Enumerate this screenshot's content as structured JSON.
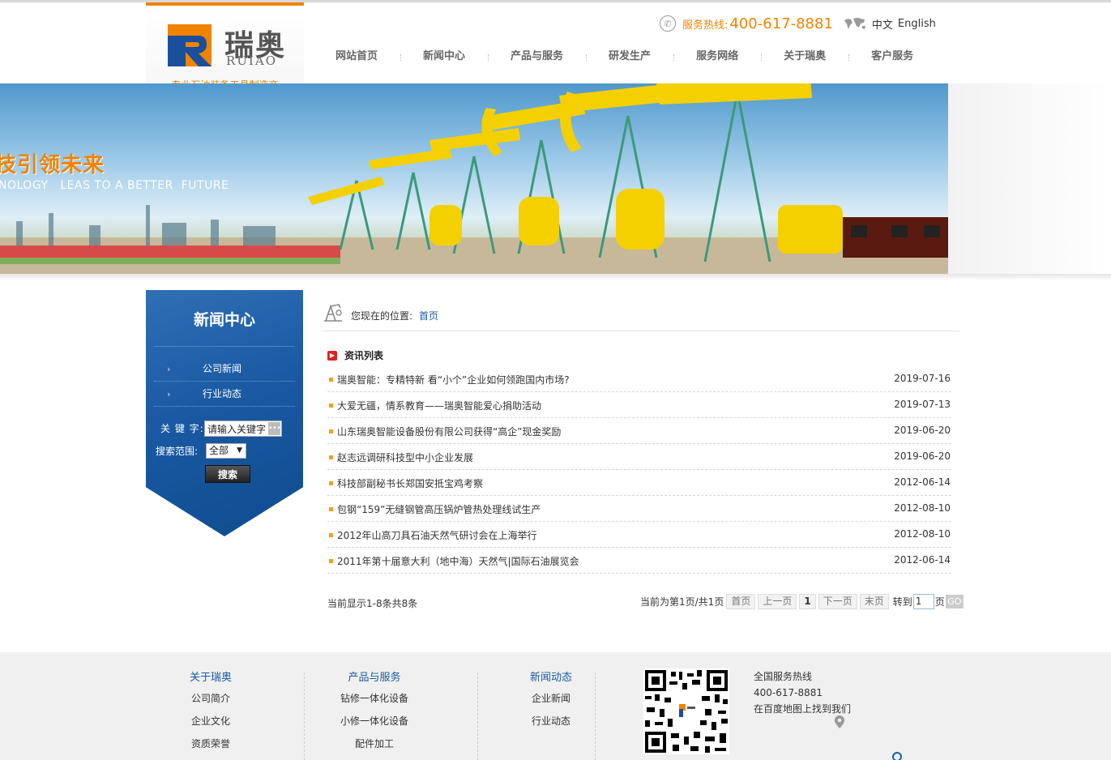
{
  "header": {
    "logo_cn": "瑞奥",
    "logo_en": "RUIAO",
    "slogan": "专业石油装备工具制造商",
    "hotline_label": "服务热线:",
    "hotline_number": "400-617-8881",
    "lang_cn": "中文",
    "lang_en": "English",
    "nav": [
      "网站首页",
      "新闻中心",
      "产品与服务",
      "研发生产",
      "服务网络",
      "关于瑞奥",
      "客户服务"
    ]
  },
  "banner": {
    "cn": "技引领未来",
    "en": "NOLOGY   LEAS TO A BETTER  FUTURE"
  },
  "sidebar": {
    "title": "新闻中心",
    "items": [
      "公司新闻",
      "行业动态"
    ],
    "keyword_label": "关 键 字:",
    "keyword_value": "请输入关键字",
    "range_label": "搜索范围:",
    "range_value": "全部",
    "search_button": "搜索"
  },
  "breadcrumb": {
    "prefix": "您现在的位置:",
    "home": "首页"
  },
  "list": {
    "title": "资讯列表",
    "items": [
      {
        "title": "瑞奥智能：专精特新 看“小个”企业如何领跑国内市场?",
        "date": "2019-07-16"
      },
      {
        "title": "大爱无疆，情系教育——瑞奥智能爱心捐助活动",
        "date": "2019-07-13"
      },
      {
        "title": "山东瑞奥智能设备股份有限公司获得“高企”现金奖励",
        "date": "2019-06-20"
      },
      {
        "title": "赵志远调研科技型中小企业发展",
        "date": "2019-06-20"
      },
      {
        "title": "科技部副秘书长郑国安抵宝鸡考察",
        "date": "2012-06-14"
      },
      {
        "title": "包钢“159”无缝钢管高压锅炉管热处理线试生产",
        "date": "2012-08-10"
      },
      {
        "title": "2012年山高刀具石油天然气研讨会在上海举行",
        "date": "2012-08-10"
      },
      {
        "title": "2011年第十届意大利（地中海）天然气|国际石油展览会",
        "date": "2012-06-14"
      }
    ]
  },
  "pager": {
    "summary": "当前显示1-8条共8条",
    "status": "当前为第1页/共1页",
    "first": "首页",
    "prev": "上一页",
    "current": "1",
    "next": "下一页",
    "last": "末页",
    "goto_label": "转到",
    "goto_value": "1",
    "page_suffix": "页",
    "go": "GO"
  },
  "footer": {
    "col1": {
      "title": "关于瑞奥",
      "links": [
        "公司简介",
        "企业文化",
        "资质荣誉"
      ]
    },
    "col2": {
      "title": "产品与服务",
      "links": [
        "钻修一体化设备",
        "小修一体化设备",
        "配件加工"
      ]
    },
    "col3": {
      "title": "新闻动态",
      "links": [
        "企业新闻",
        "行业动态"
      ]
    },
    "hotline_title": "全国服务热线",
    "hotline_number": "400-617-8881",
    "map_text": "在百度地图上找到我们"
  },
  "colors": {
    "accent": "#f08300",
    "brand_blue": "#1a5aa3"
  }
}
